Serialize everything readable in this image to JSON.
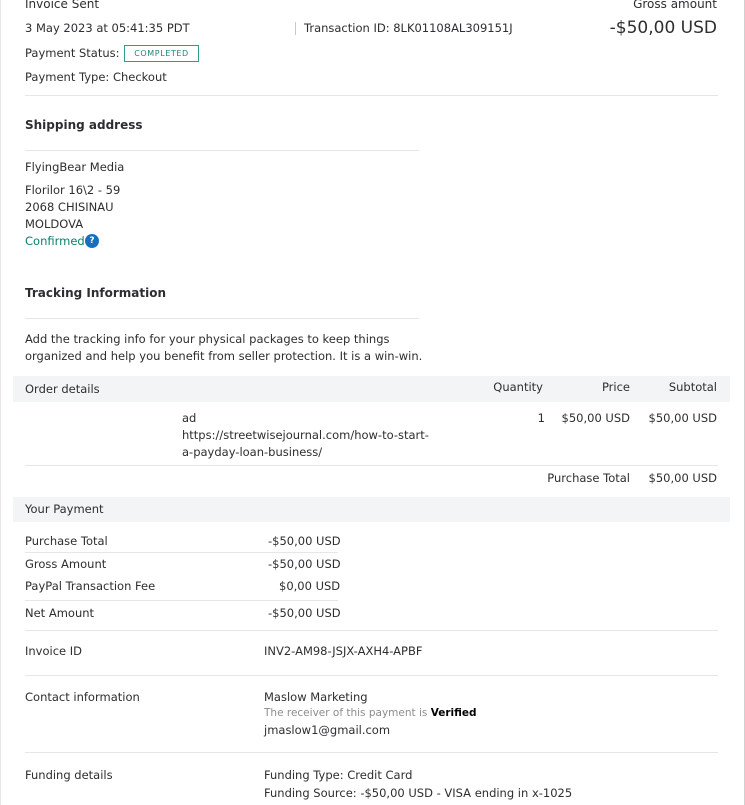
{
  "header": {
    "title": "Invoice Sent",
    "gross_label": "Gross amount",
    "datetime": "3 May 2023 at 05:41:35 PDT",
    "transaction_id": "Transaction ID: 8LK01108AL309151J",
    "gross_amount": "-$50,00 USD",
    "payment_status_label": "Payment Status:",
    "payment_status_value": "COMPLETED",
    "payment_type": "Payment Type: Checkout"
  },
  "shipping": {
    "title": "Shipping address",
    "name": "FlyingBear Media",
    "line1": "Florilor 16\\2 - 59",
    "line2": "2068 CHISINAU",
    "country": "MOLDOVA",
    "confirmed": "Confirmed",
    "help_glyph": "?"
  },
  "tracking": {
    "title": "Tracking Information",
    "desc1": "Add the tracking info for your physical packages to keep things",
    "desc2": "organized and help you benefit from seller protection. It is a win-win."
  },
  "order": {
    "header_label": "Order details",
    "col_quantity": "Quantity",
    "col_price": "Price",
    "col_subtotal": "Subtotal",
    "item_name": "ad",
    "item_url1": "https://streetwisejournal.com/how-to-start-",
    "item_url2": "a-payday-loan-business/",
    "item_qty": "1",
    "item_price": "$50,00 USD",
    "item_subtotal": "$50,00 USD",
    "total_label": "Purchase Total",
    "total_value": "$50,00 USD"
  },
  "payment": {
    "header_label": "Your Payment",
    "rows": [
      {
        "label": "Purchase Total",
        "value": "-$50,00 USD"
      },
      {
        "label": "Gross Amount",
        "value": "-$50,00 USD"
      },
      {
        "label": "PayPal Transaction Fee",
        "value": "$0,00 USD"
      },
      {
        "label": "Net Amount",
        "value": "-$50,00 USD"
      }
    ]
  },
  "invoice": {
    "label": "Invoice ID",
    "value": "INV2-AM98-JSJX-AXH4-APBF"
  },
  "contact": {
    "label": "Contact information",
    "name": "Maslow Marketing",
    "verified_prefix": "The receiver of this payment is ",
    "verified_word": "Verified",
    "email": "jmaslow1@gmail.com"
  },
  "funding": {
    "label": "Funding details",
    "type": "Funding Type: Credit Card",
    "source": "Funding Source: -$50,00 USD - VISA ending in x-1025"
  }
}
